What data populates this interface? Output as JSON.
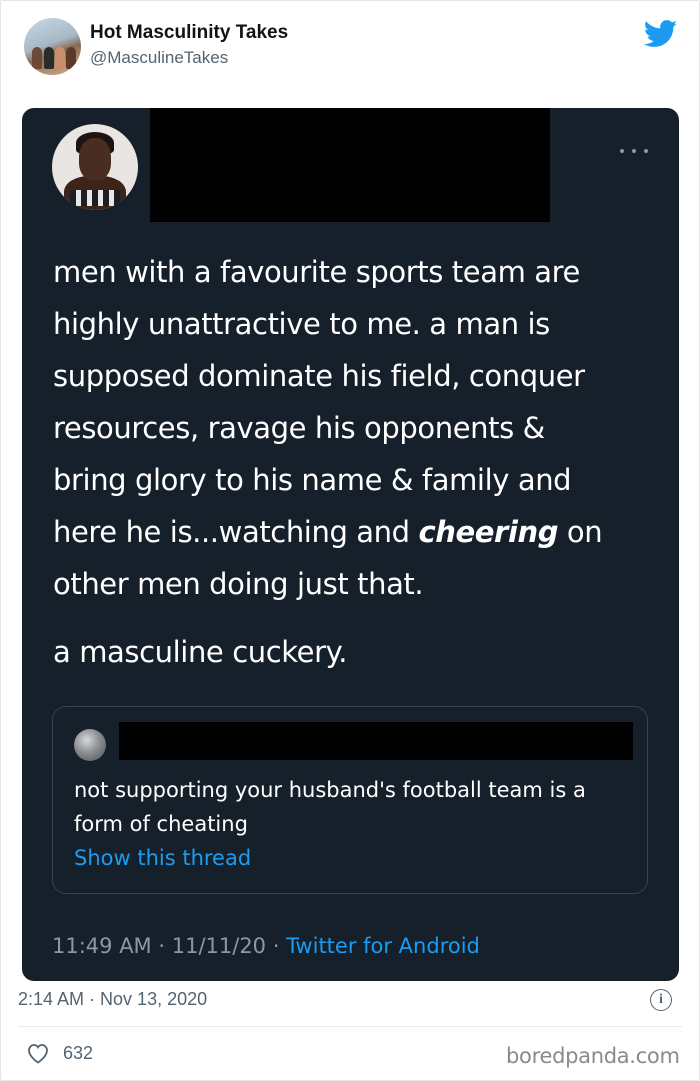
{
  "account": {
    "display_name": "Hot Masculinity Takes",
    "handle": "@MasculineTakes"
  },
  "embedded_tweet": {
    "lines_before_emphasis": "men with a favourite sports team are\nhighly unattractive to me. a man is\nsupposed dominate his field, conquer\nresources, ravage his opponents &\nbring glory to his name & family and\nhere he is...watching and ",
    "emphasis": "cheering",
    "lines_after_emphasis": " on\nother men doing just that.",
    "second_paragraph": "a masculine cuckery.",
    "quoted_tweet": {
      "text": "not supporting your husband's football team is a form of cheating",
      "show_thread_label": "Show this thread"
    },
    "time": "11:49 AM",
    "date": "11/11/20",
    "source": "Twitter for Android",
    "separator": " · "
  },
  "post": {
    "time": "2:14 AM",
    "date": "Nov 13, 2020",
    "separator": " · ",
    "like_count": "632"
  },
  "watermark": "boredpanda.com",
  "colors": {
    "card_background": "#15202b",
    "link_blue": "#1d9bf0",
    "twitter_blue": "#1d9bf0",
    "muted_gray": "#536471"
  }
}
